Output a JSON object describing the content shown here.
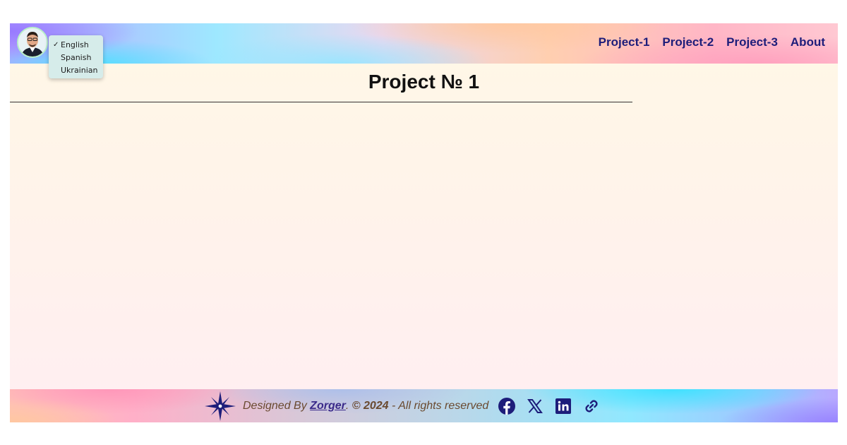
{
  "header": {
    "avatar_alt": "",
    "language_menu": {
      "items": [
        {
          "label": "English",
          "selected": true,
          "check": "✓"
        },
        {
          "label": "Spanish",
          "selected": false,
          "check": ""
        },
        {
          "label": "Ukrainian",
          "selected": false,
          "check": ""
        }
      ]
    },
    "nav": [
      "Project-1",
      "Project-2",
      "Project-3",
      "About"
    ]
  },
  "main": {
    "title": "Project № 1"
  },
  "footer": {
    "designed_by": "Designed By",
    "author": "Zorger",
    "period": ".",
    "year": "© 2024",
    "rights": "- All rights reserved",
    "icons": [
      "facebook-icon",
      "x-icon",
      "linkedin-icon",
      "link-icon"
    ]
  },
  "colors": {
    "nav_text": "#1d1d7a",
    "footer_text": "#6a4a30",
    "author_link": "#3a2a8a",
    "icon_color": "#1d1d7a"
  }
}
